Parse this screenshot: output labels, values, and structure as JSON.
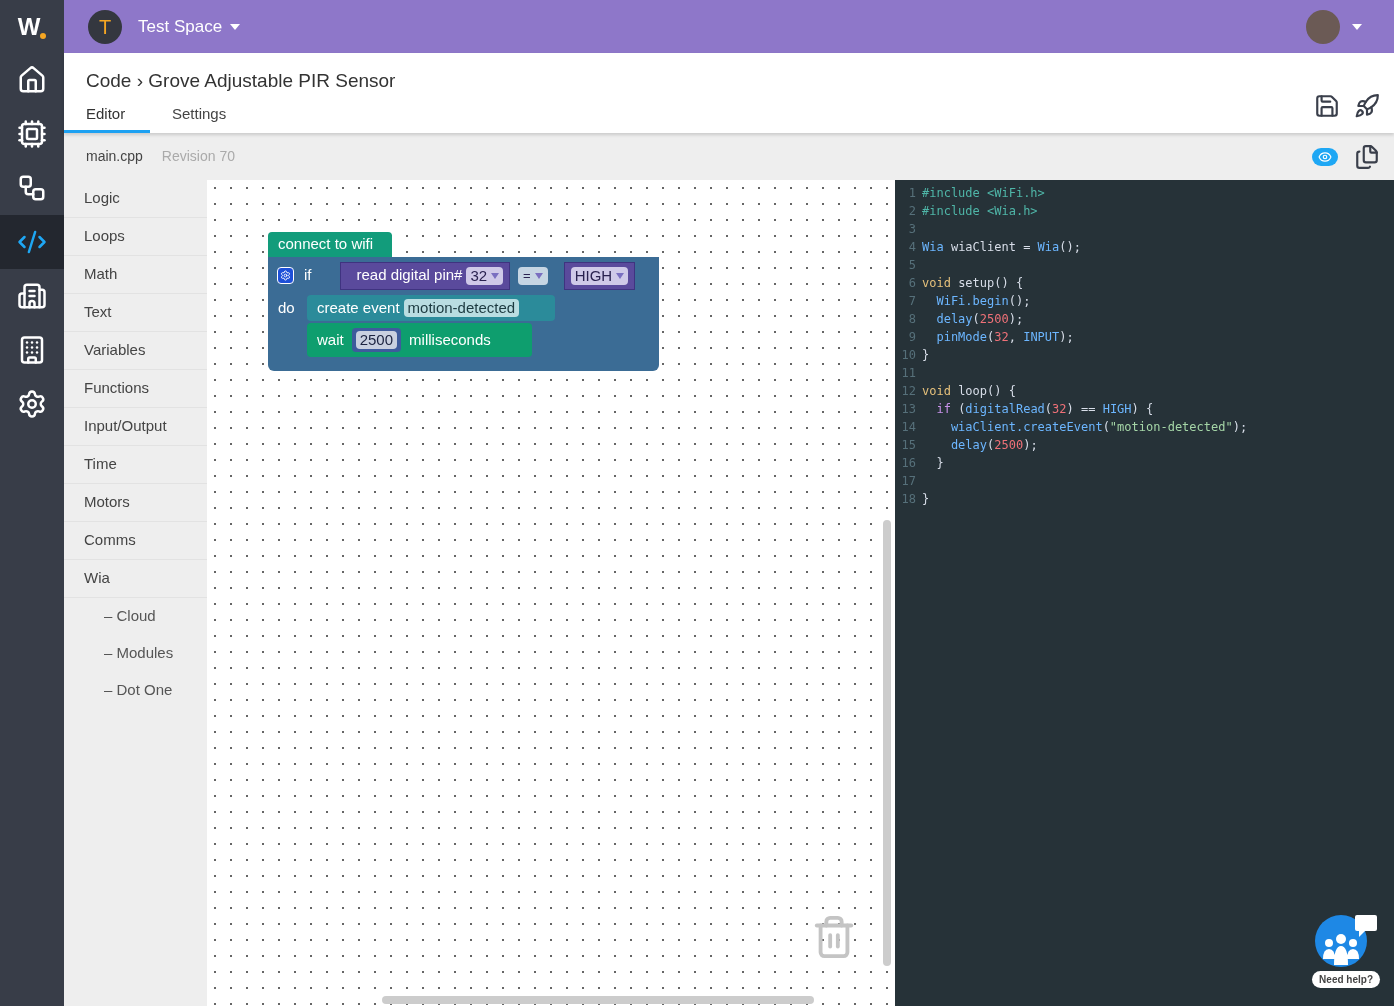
{
  "rail": {
    "logo": "W",
    "items": [
      {
        "selected": false
      },
      {
        "selected": false
      },
      {
        "selected": false
      },
      {
        "selected": true
      },
      {
        "selected": false
      },
      {
        "selected": false
      },
      {
        "selected": false
      }
    ]
  },
  "topbar": {
    "space_initial": "T",
    "space_name": "Test Space"
  },
  "title": "Code › Grove Adjustable PIR Sensor",
  "tabs": [
    {
      "label": "Editor",
      "selected": true
    },
    {
      "label": "Settings",
      "selected": false
    }
  ],
  "file": {
    "name": "main.cpp",
    "revision": "Revision 70",
    "preview_on": true
  },
  "categories": [
    {
      "label": "Logic"
    },
    {
      "label": "Loops"
    },
    {
      "label": "Math"
    },
    {
      "label": "Text"
    },
    {
      "label": "Variables"
    },
    {
      "label": "Functions"
    },
    {
      "label": "Input/Output"
    },
    {
      "label": "Time"
    },
    {
      "label": "Motors"
    },
    {
      "label": "Comms"
    },
    {
      "label": "Wia",
      "children": [
        {
          "label": "– Cloud"
        },
        {
          "label": "– Modules"
        },
        {
          "label": "– Dot One"
        }
      ]
    }
  ],
  "blocks": {
    "wifi": "connect to wifi",
    "if_label": "if",
    "do_label": "do",
    "condition": {
      "read": "read digital pin#",
      "pin": "32",
      "op": "=",
      "value": "HIGH"
    },
    "statements": [
      {
        "kind": "event",
        "label": "create event",
        "value": "motion-detected"
      },
      {
        "kind": "wait",
        "label": "wait",
        "value": "2500",
        "suffix": "milliseconds"
      }
    ]
  },
  "code": [
    {
      "n": "1",
      "tokens": [
        {
          "kind": "pre",
          "t": "#include <WiFi.h>"
        }
      ]
    },
    {
      "n": "2",
      "tokens": [
        {
          "kind": "pre",
          "t": "#include <Wia.h>"
        }
      ]
    },
    {
      "n": "3"
    },
    {
      "n": "4",
      "tokens": [
        {
          "kind": "type",
          "t": "Wia"
        },
        {
          "kind": "plain",
          "t": " wiaClient = "
        },
        {
          "kind": "type",
          "t": "Wia"
        },
        {
          "kind": "plain",
          "t": "();"
        }
      ]
    },
    {
      "n": "5"
    },
    {
      "n": "6",
      "tokens": [
        {
          "kind": "kw",
          "t": "void"
        },
        {
          "kind": "plain",
          "t": " setup() {"
        }
      ]
    },
    {
      "n": "7",
      "tokens": [
        {
          "kind": "fn",
          "t": "  WiFi.begin"
        },
        {
          "kind": "plain",
          "t": "();"
        }
      ]
    },
    {
      "n": "8",
      "tokens": [
        {
          "kind": "fn",
          "t": "  delay"
        },
        {
          "kind": "plain",
          "t": "("
        },
        {
          "kind": "num",
          "t": "2500"
        },
        {
          "kind": "plain",
          "t": ");"
        }
      ]
    },
    {
      "n": "9",
      "tokens": [
        {
          "kind": "fn",
          "t": "  pinMode"
        },
        {
          "kind": "plain",
          "t": "("
        },
        {
          "kind": "num",
          "t": "32"
        },
        {
          "kind": "plain",
          "t": ", "
        },
        {
          "kind": "fn",
          "t": "INPUT"
        },
        {
          "kind": "plain",
          "t": ");"
        }
      ]
    },
    {
      "n": "10",
      "tokens": [
        {
          "kind": "plain",
          "t": "}"
        }
      ]
    },
    {
      "n": "11"
    },
    {
      "n": "12",
      "tokens": [
        {
          "kind": "kw",
          "t": "void"
        },
        {
          "kind": "plain",
          "t": " loop() {"
        }
      ]
    },
    {
      "n": "13",
      "tokens": [
        {
          "kind": "ctl",
          "t": "  if"
        },
        {
          "kind": "plain",
          "t": " ("
        },
        {
          "kind": "fn",
          "t": "digitalRead"
        },
        {
          "kind": "plain",
          "t": "("
        },
        {
          "kind": "num",
          "t": "32"
        },
        {
          "kind": "plain",
          "t": ") == "
        },
        {
          "kind": "fn",
          "t": "HIGH"
        },
        {
          "kind": "plain",
          "t": ") {"
        }
      ]
    },
    {
      "n": "14",
      "tokens": [
        {
          "kind": "fn",
          "t": "    wiaClient.createEvent"
        },
        {
          "kind": "plain",
          "t": "("
        },
        {
          "kind": "str",
          "t": "\"motion-detected\""
        },
        {
          "kind": "plain",
          "t": ");"
        }
      ]
    },
    {
      "n": "15",
      "tokens": [
        {
          "kind": "fn",
          "t": "    delay"
        },
        {
          "kind": "plain",
          "t": "("
        },
        {
          "kind": "num",
          "t": "2500"
        },
        {
          "kind": "plain",
          "t": ");"
        }
      ]
    },
    {
      "n": "16",
      "tokens": [
        {
          "kind": "plain",
          "t": "  }"
        }
      ]
    },
    {
      "n": "17"
    },
    {
      "n": "18",
      "tokens": [
        {
          "kind": "plain",
          "t": "}"
        }
      ]
    }
  ],
  "help": {
    "label": "Need help?"
  }
}
